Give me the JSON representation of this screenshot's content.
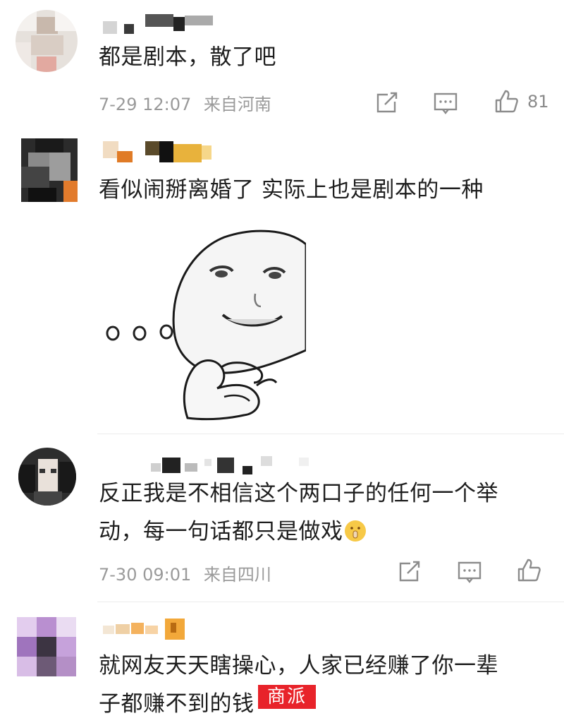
{
  "comments": [
    {
      "text": "都是剧本，散了吧",
      "date": "7-29 12:07",
      "location": "来自河南",
      "likes": "81"
    },
    {
      "text": "看似闹掰离婚了 实际上也是剧本的一种"
    },
    {
      "text_line1": "反正我是不相信这个两口子的任何一个举",
      "text_line2": "动，每一句话都只是做戏",
      "date": "7-30 09:01",
      "location": "来自四川"
    },
    {
      "text_line1": "就网友天天瞎操心，人家已经赚了你一辈",
      "text_line2": "子都赚不到的钱"
    }
  ],
  "watermark": "商派",
  "icons": {
    "share": "share-icon",
    "reply": "comment-icon",
    "like": "thumbs-up-icon",
    "sticker": "thinking-face-sticker",
    "emoji": "shushing-face-emoji"
  }
}
